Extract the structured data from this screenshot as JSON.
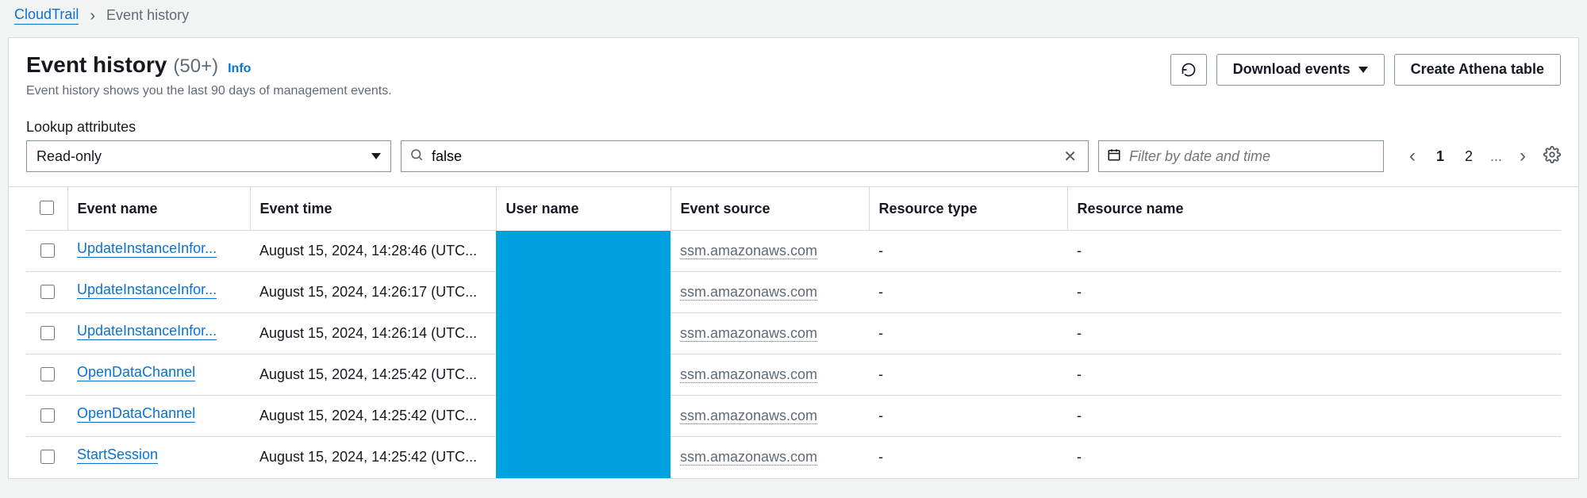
{
  "breadcrumbs": {
    "root": "CloudTrail",
    "current": "Event history"
  },
  "header": {
    "title": "Event history",
    "count": "(50+)",
    "info": "Info",
    "subtitle": "Event history shows you the last 90 days of management events."
  },
  "actions": {
    "download": "Download events",
    "athena": "Create Athena table"
  },
  "lookup": {
    "label": "Lookup attributes",
    "select_value": "Read-only",
    "input_value": "false",
    "date_placeholder": "Filter by date and time"
  },
  "pager": {
    "current": "1",
    "next": "2",
    "ellipsis": "..."
  },
  "columns": {
    "name": "Event name",
    "time": "Event time",
    "user": "User name",
    "source": "Event source",
    "rtype": "Resource type",
    "rname": "Resource name"
  },
  "rows": [
    {
      "name": "UpdateInstanceInfor...",
      "time": "August 15, 2024, 14:28:46 (UTC...",
      "source": "ssm.amazonaws.com",
      "rtype": "-",
      "rname": "-"
    },
    {
      "name": "UpdateInstanceInfor...",
      "time": "August 15, 2024, 14:26:17 (UTC...",
      "source": "ssm.amazonaws.com",
      "rtype": "-",
      "rname": "-"
    },
    {
      "name": "UpdateInstanceInfor...",
      "time": "August 15, 2024, 14:26:14 (UTC...",
      "source": "ssm.amazonaws.com",
      "rtype": "-",
      "rname": "-"
    },
    {
      "name": "OpenDataChannel",
      "time": "August 15, 2024, 14:25:42 (UTC...",
      "source": "ssm.amazonaws.com",
      "rtype": "-",
      "rname": "-"
    },
    {
      "name": "OpenDataChannel",
      "time": "August 15, 2024, 14:25:42 (UTC...",
      "source": "ssm.amazonaws.com",
      "rtype": "-",
      "rname": "-"
    },
    {
      "name": "StartSession",
      "time": "August 15, 2024, 14:25:42 (UTC...",
      "source": "ssm.amazonaws.com",
      "rtype": "-",
      "rname": "-"
    }
  ]
}
